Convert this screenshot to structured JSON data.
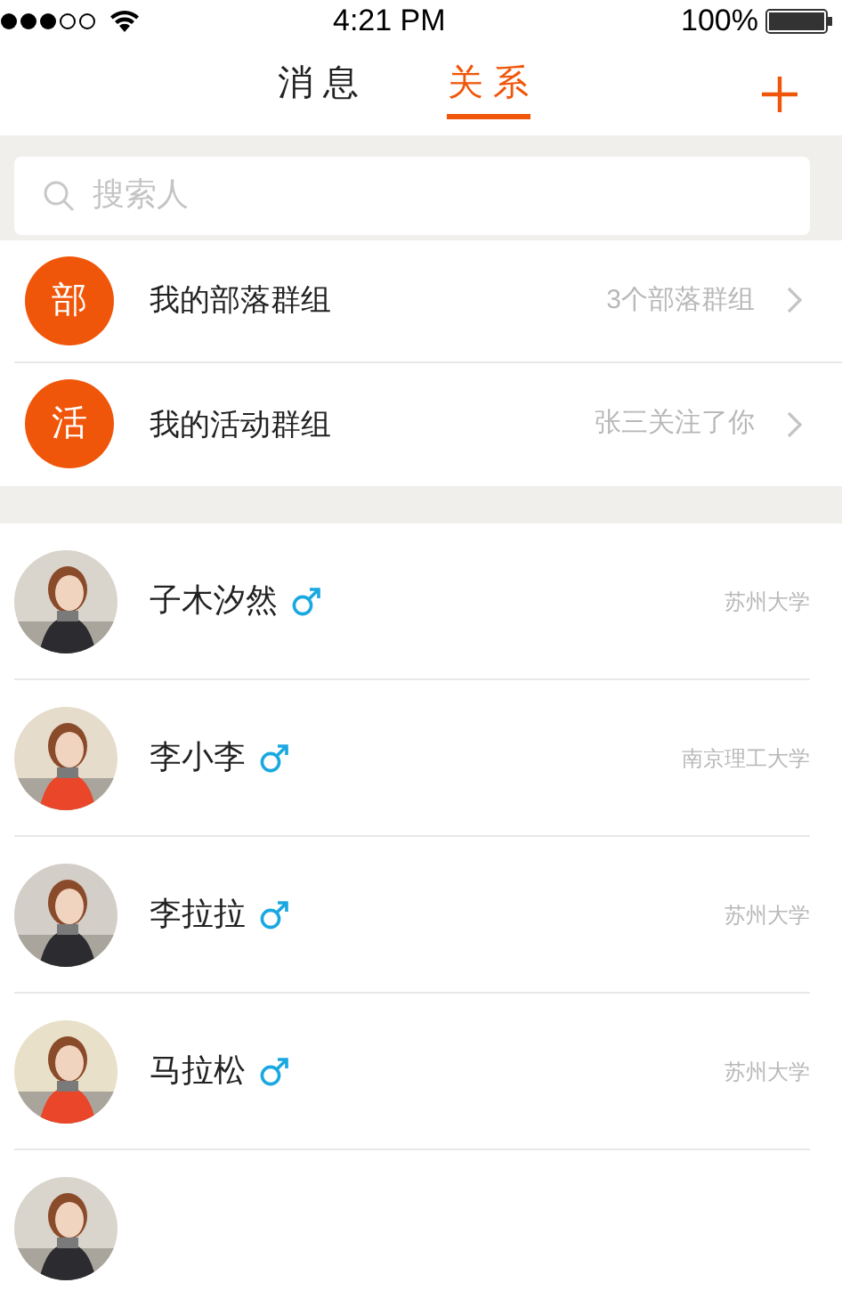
{
  "status_bar": {
    "time": "4:21 PM",
    "battery": "100%"
  },
  "tabs": [
    {
      "label": "消 息",
      "selected": false
    },
    {
      "label": "关 系",
      "selected": true
    }
  ],
  "search": {
    "placeholder": "搜索人"
  },
  "groups": [
    {
      "badge": "部",
      "name": "我的部落群组",
      "detail": "3个部落群组"
    },
    {
      "badge": "活",
      "name": "我的活动群组",
      "detail": "张三关注了你"
    }
  ],
  "contacts": [
    {
      "kind": "male",
      "name": "子木汐然",
      "school": "苏州大学"
    },
    {
      "kind": "male",
      "name": "李小李",
      "school": "南京理工大学"
    },
    {
      "kind": "male",
      "name": "李拉拉",
      "school": "苏州大学"
    },
    {
      "kind": "male",
      "name": "马拉松",
      "school": "苏州大学"
    },
    {
      "kind": "cut_off"
    }
  ]
}
